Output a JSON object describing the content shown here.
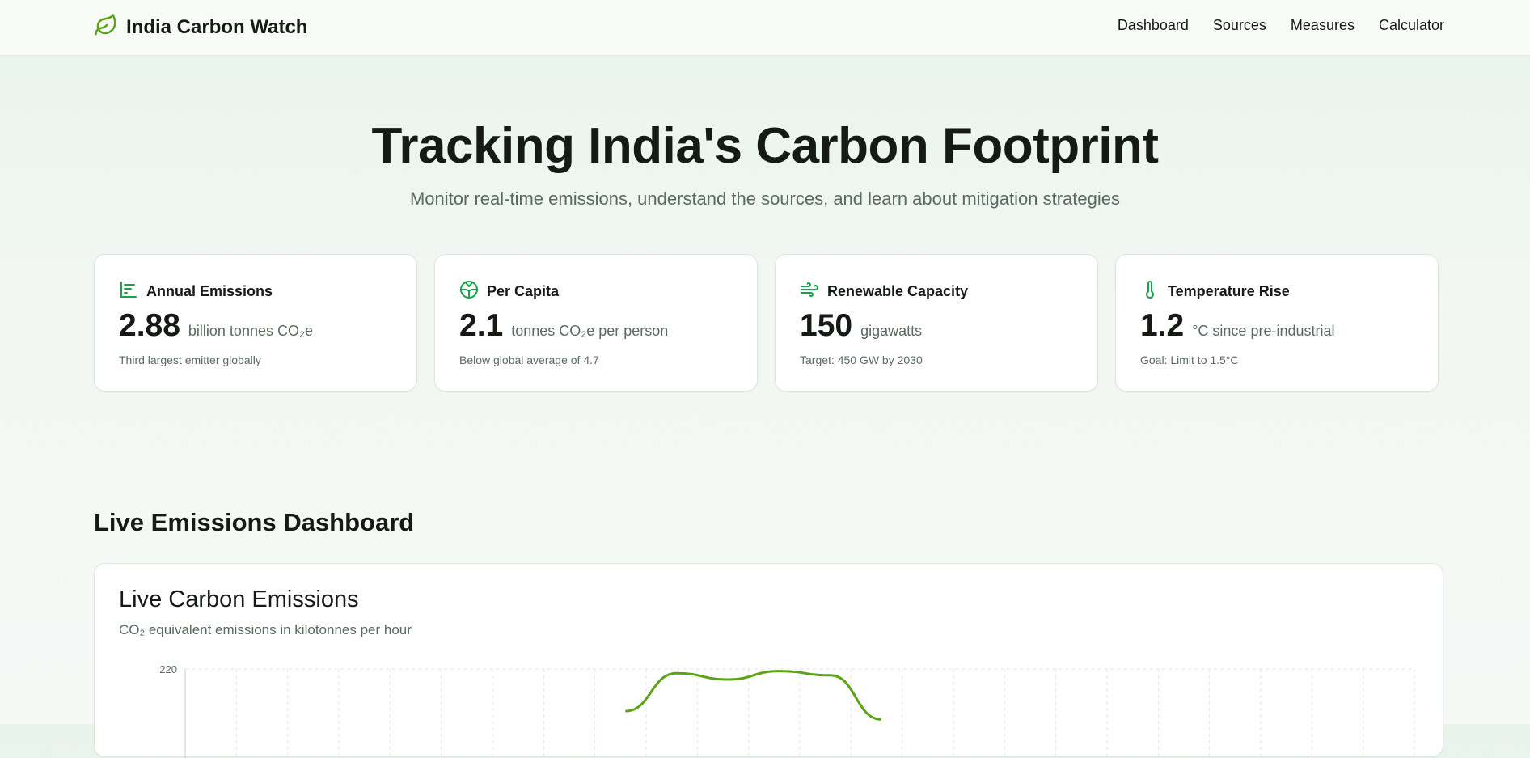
{
  "nav": {
    "brand": "India Carbon Watch",
    "links": [
      "Dashboard",
      "Sources",
      "Measures",
      "Calculator"
    ]
  },
  "hero": {
    "title": "Tracking India's Carbon Footprint",
    "subtitle": "Monitor real-time emissions, understand the sources, and learn about mitigation strategies"
  },
  "stats": [
    {
      "icon": "bar-chart-icon",
      "label": "Annual Emissions",
      "value": "2.88",
      "unit": "billion tonnes CO₂e",
      "note": "Third largest emitter globally"
    },
    {
      "icon": "globe-icon",
      "label": "Per Capita",
      "value": "2.1",
      "unit": "tonnes CO₂e per person",
      "note": "Below global average of 4.7"
    },
    {
      "icon": "wind-icon",
      "label": "Renewable Capacity",
      "value": "150",
      "unit": "gigawatts",
      "note": "Target: 450 GW by 2030"
    },
    {
      "icon": "thermometer-icon",
      "label": "Temperature Rise",
      "value": "1.2",
      "unit": "°C since pre-industrial",
      "note": "Goal: Limit to 1.5°C"
    }
  ],
  "dashboard": {
    "section_title": "Live Emissions Dashboard",
    "card_title": "Live Carbon Emissions",
    "card_subtitle": "CO₂ equivalent emissions in kilotonnes per hour"
  },
  "colors": {
    "accent": "#16a34a",
    "line": "#5aa317",
    "text": "#151a15",
    "muted": "#5a6a5e"
  },
  "chart_data": {
    "type": "line",
    "y_ticks_visible": [
      220
    ],
    "series": [
      {
        "values": [
          null,
          null,
          null,
          null,
          null,
          null,
          null,
          null,
          200,
          218,
          215,
          219,
          217,
          196,
          null,
          null,
          null,
          null,
          null,
          null,
          null,
          null,
          null,
          null
        ]
      }
    ],
    "grid": true
  }
}
